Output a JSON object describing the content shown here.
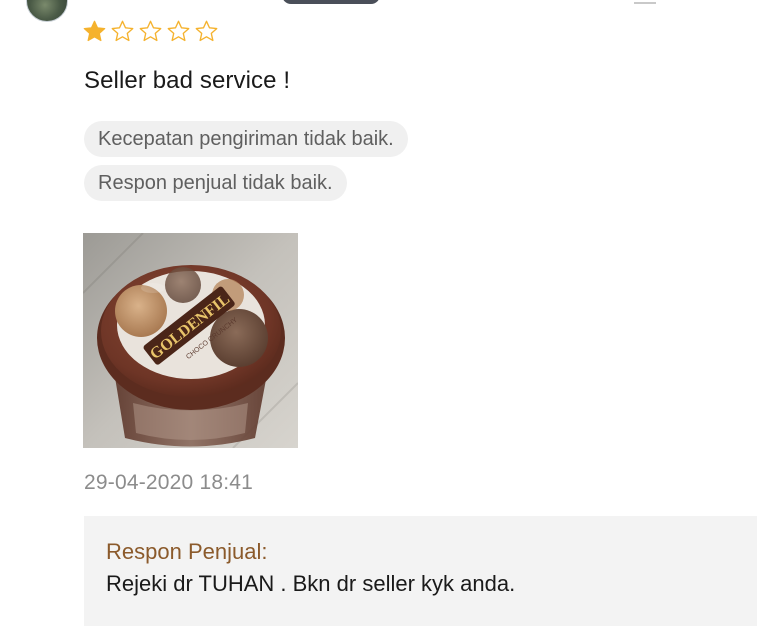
{
  "review": {
    "rating": 1,
    "rating_max": 5,
    "text": "Seller bad service !",
    "tags": [
      "Kecepatan pengiriman tidak baik.",
      "Respon penjual tidak baik."
    ],
    "photo": {
      "product_label": "GOLDENFIL",
      "product_sub": "CHOCO CRUNCHY"
    },
    "timestamp": "29-04-2020 18:41"
  },
  "seller_response": {
    "label": "Respon Penjual:",
    "text": "Rejeki dr TUHAN . Bkn dr seller kyk anda."
  },
  "colors": {
    "star_filled": "#f5b22d",
    "star_empty_stroke": "#f5b22d",
    "seller_label": "#8b5a2b",
    "tag_bg": "#f0f0f0",
    "reply_bg": "#f3f3f3"
  }
}
